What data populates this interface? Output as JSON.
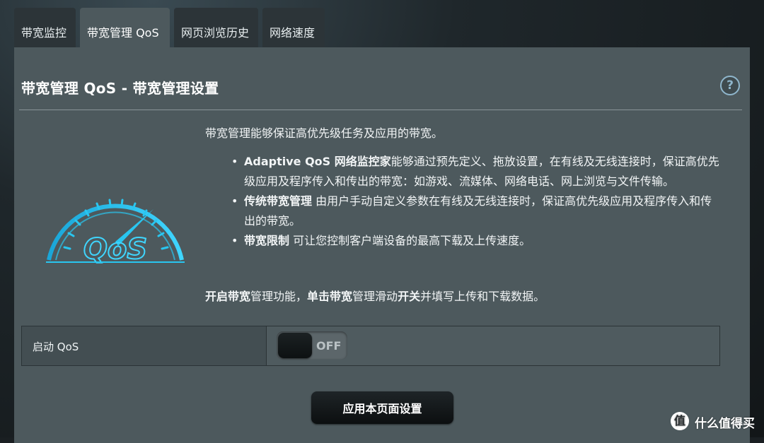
{
  "tabs": [
    {
      "label": "带宽监控"
    },
    {
      "label": "带宽管理 QoS"
    },
    {
      "label": "网页浏览历史"
    },
    {
      "label": "网络速度"
    }
  ],
  "panel": {
    "title": "带宽管理 QoS - 带宽管理设置",
    "help_label": "?",
    "intro": "带宽管理能够保证高优先级任务及应用的带宽。",
    "features": [
      {
        "name": "Adaptive QoS 网络监控家",
        "text": "能够通过预先定义、拖放设置，在有线及无线连接时，保证高优先级应用及程序传入和传出的带宽：如游戏、流媒体、网络电话、网上浏览与文件传输。"
      },
      {
        "name": "传统带宽管理",
        "text": "由用户手动自定义参数在有线及无线连接时，保证高优先级应用及程序传入和传出的带宽。"
      },
      {
        "name": "带宽限制",
        "text": "可让您控制客户端设备的最高下载及上传速度。"
      }
    ],
    "closing": {
      "bold_1": "开启带宽",
      "text_1": "管理功能，",
      "bold_2": "单击带宽",
      "text_2": "管理滑动",
      "bold_3": "开关",
      "text_3": "并填写上传和下载数据。"
    },
    "logo_text": "QoS",
    "setting": {
      "label": "启动 QoS",
      "toggle_state": "OFF"
    },
    "apply_button": "应用本页面设置"
  },
  "watermark": {
    "icon_glyph": "值",
    "text": "什么值得买"
  },
  "colors": {
    "panel_bg": "#4d595d",
    "tab_bg": "#2c3438",
    "accent": "#29c6f0"
  }
}
